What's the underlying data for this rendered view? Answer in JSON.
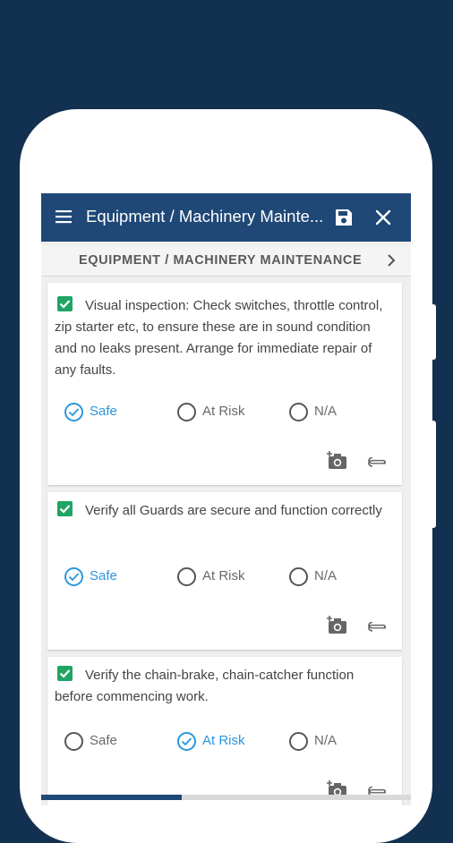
{
  "colors": {
    "background": "#12304f",
    "primary": "#1f4877",
    "accent": "#2b96de",
    "green": "#1fa464"
  },
  "appbar": {
    "title": "Equipment / Machinery Mainte...",
    "menu_icon": "hamburger-menu-icon",
    "save_icon": "save-icon",
    "close_icon": "close-icon"
  },
  "section": {
    "title": "EQUIPMENT / MACHINERY MAINTENANCE",
    "next_icon": "chevron-right-icon"
  },
  "options_labels": [
    "Safe",
    "At Risk",
    "N/A"
  ],
  "items": [
    {
      "question": "Visual inspection: Check switches, throttle control, zip starter etc, to ensure these are in sound condition and no leaks present. Arrange for immediate repair of any faults.",
      "options": [
        "Safe",
        "At Risk",
        "N/A"
      ],
      "selected": "Safe"
    },
    {
      "question": "Verify all Guards are secure and function correctly",
      "options": [
        "Safe",
        "At Risk",
        "N/A"
      ],
      "selected": "Safe"
    },
    {
      "question": "Verify the chain-brake, chain-catcher function before commencing work.",
      "options": [
        "Safe",
        "At Risk",
        "N/A"
      ],
      "selected": "At Risk"
    }
  ],
  "progress": 0.38
}
